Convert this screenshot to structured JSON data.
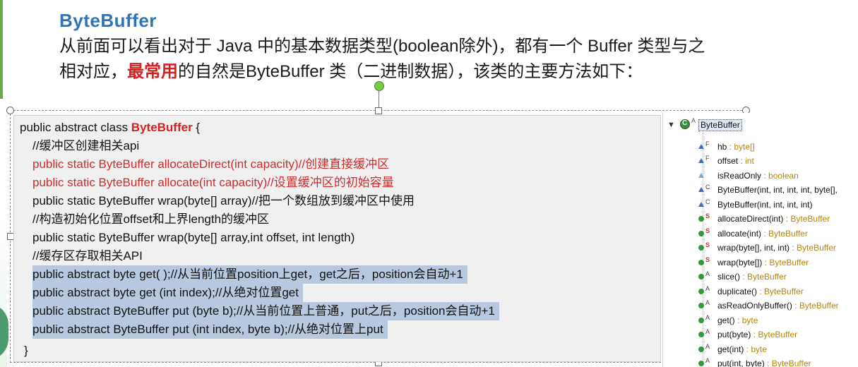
{
  "slide": {
    "title": "ByteBuffer",
    "line1": "从前面可以看出对于 Java 中的基本数据类型(boolean除外)，都有一个 Buffer 类型与之",
    "line2_pre": "相对应，",
    "line2_emph": "最常用",
    "line2_post": "的自然是ByteBuffer 类（二进制数据），该类的主要方法如下："
  },
  "code": {
    "decl_prefix": "public abstract class ",
    "decl_class": "ByteBuffer",
    "decl_suffix": " {",
    "lines": [
      "//缓冲区创建相关api",
      "public static ByteBuffer allocateDirect(int capacity)//创建直接缓冲区",
      "public static ByteBuffer allocate(int capacity)//设置缓冲区的初始容量",
      "public static ByteBuffer wrap(byte[] array)//把一个数组放到缓冲区中使用",
      "//构造初始化位置offset和上界length的缓冲区",
      "public static ByteBuffer wrap(byte[] array,int offset, int length)",
      " //缓存区存取相关API",
      "public abstract byte get( );//从当前位置position上get，get之后，position会自动+1",
      "public abstract byte get (int index);//从绝对位置get",
      "public abstract ByteBuffer put (byte b);//从当前位置上普通，put之后，position会自动+1",
      "public abstract ByteBuffer put (int index, byte b);//从绝对位置上put"
    ],
    "closing": "}"
  },
  "outline": {
    "root_label": "ByteBuffer",
    "root_modifier": "A",
    "items": [
      {
        "mod": "F",
        "name": "hb",
        "type": " : byte[]"
      },
      {
        "mod": "F",
        "name": "offset",
        "type": " : int"
      },
      {
        "mod": "",
        "name": "isReadOnly",
        "type": " : boolean"
      },
      {
        "mod": "C",
        "name": "ByteBuffer(int, int, int, int, byte[],",
        "type": ""
      },
      {
        "mod": "C",
        "name": "ByteBuffer(int, int, int, int)",
        "type": ""
      },
      {
        "mod": "S",
        "name": "allocateDirect(int)",
        "type": " : ByteBuffer"
      },
      {
        "mod": "S",
        "name": "allocate(int)",
        "type": " : ByteBuffer"
      },
      {
        "mod": "S",
        "name": "wrap(byte[], int, int)",
        "type": " : ByteBuffer"
      },
      {
        "mod": "S",
        "name": "wrap(byte[])",
        "type": " : ByteBuffer"
      },
      {
        "mod": "A",
        "name": "slice()",
        "type": " : ByteBuffer"
      },
      {
        "mod": "A",
        "name": "duplicate()",
        "type": " : ByteBuffer"
      },
      {
        "mod": "A",
        "name": "asReadOnlyBuffer()",
        "type": " : ByteBuffer"
      },
      {
        "mod": "A",
        "name": "get()",
        "type": " : byte"
      },
      {
        "mod": "A",
        "name": "put(byte)",
        "type": " : ByteBuffer"
      },
      {
        "mod": "A",
        "name": "get(int)",
        "type": " : byte"
      },
      {
        "mod": "A",
        "name": "put(int, byte)",
        "type": " : ByteBuffer"
      }
    ]
  }
}
